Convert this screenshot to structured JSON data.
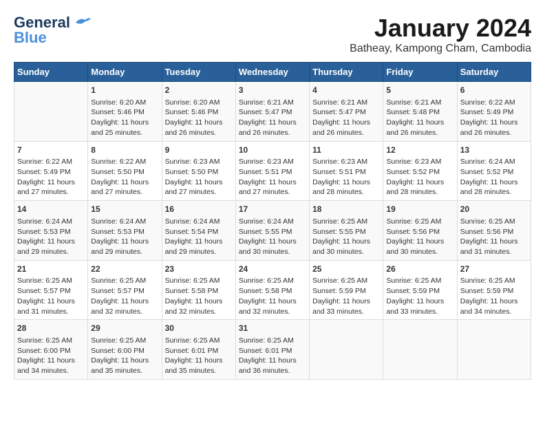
{
  "header": {
    "logo_line1": "General",
    "logo_line2": "Blue",
    "month_title": "January 2024",
    "subtitle": "Batheay, Kampong Cham, Cambodia"
  },
  "days_of_week": [
    "Sunday",
    "Monday",
    "Tuesday",
    "Wednesday",
    "Thursday",
    "Friday",
    "Saturday"
  ],
  "weeks": [
    {
      "days": [
        {
          "num": "",
          "content": ""
        },
        {
          "num": "1",
          "content": "Sunrise: 6:20 AM\nSunset: 5:46 PM\nDaylight: 11 hours\nand 25 minutes."
        },
        {
          "num": "2",
          "content": "Sunrise: 6:20 AM\nSunset: 5:46 PM\nDaylight: 11 hours\nand 26 minutes."
        },
        {
          "num": "3",
          "content": "Sunrise: 6:21 AM\nSunset: 5:47 PM\nDaylight: 11 hours\nand 26 minutes."
        },
        {
          "num": "4",
          "content": "Sunrise: 6:21 AM\nSunset: 5:47 PM\nDaylight: 11 hours\nand 26 minutes."
        },
        {
          "num": "5",
          "content": "Sunrise: 6:21 AM\nSunset: 5:48 PM\nDaylight: 11 hours\nand 26 minutes."
        },
        {
          "num": "6",
          "content": "Sunrise: 6:22 AM\nSunset: 5:49 PM\nDaylight: 11 hours\nand 26 minutes."
        }
      ]
    },
    {
      "days": [
        {
          "num": "7",
          "content": "Sunrise: 6:22 AM\nSunset: 5:49 PM\nDaylight: 11 hours\nand 27 minutes."
        },
        {
          "num": "8",
          "content": "Sunrise: 6:22 AM\nSunset: 5:50 PM\nDaylight: 11 hours\nand 27 minutes."
        },
        {
          "num": "9",
          "content": "Sunrise: 6:23 AM\nSunset: 5:50 PM\nDaylight: 11 hours\nand 27 minutes."
        },
        {
          "num": "10",
          "content": "Sunrise: 6:23 AM\nSunset: 5:51 PM\nDaylight: 11 hours\nand 27 minutes."
        },
        {
          "num": "11",
          "content": "Sunrise: 6:23 AM\nSunset: 5:51 PM\nDaylight: 11 hours\nand 28 minutes."
        },
        {
          "num": "12",
          "content": "Sunrise: 6:23 AM\nSunset: 5:52 PM\nDaylight: 11 hours\nand 28 minutes."
        },
        {
          "num": "13",
          "content": "Sunrise: 6:24 AM\nSunset: 5:52 PM\nDaylight: 11 hours\nand 28 minutes."
        }
      ]
    },
    {
      "days": [
        {
          "num": "14",
          "content": "Sunrise: 6:24 AM\nSunset: 5:53 PM\nDaylight: 11 hours\nand 29 minutes."
        },
        {
          "num": "15",
          "content": "Sunrise: 6:24 AM\nSunset: 5:53 PM\nDaylight: 11 hours\nand 29 minutes."
        },
        {
          "num": "16",
          "content": "Sunrise: 6:24 AM\nSunset: 5:54 PM\nDaylight: 11 hours\nand 29 minutes."
        },
        {
          "num": "17",
          "content": "Sunrise: 6:24 AM\nSunset: 5:55 PM\nDaylight: 11 hours\nand 30 minutes."
        },
        {
          "num": "18",
          "content": "Sunrise: 6:25 AM\nSunset: 5:55 PM\nDaylight: 11 hours\nand 30 minutes."
        },
        {
          "num": "19",
          "content": "Sunrise: 6:25 AM\nSunset: 5:56 PM\nDaylight: 11 hours\nand 30 minutes."
        },
        {
          "num": "20",
          "content": "Sunrise: 6:25 AM\nSunset: 5:56 PM\nDaylight: 11 hours\nand 31 minutes."
        }
      ]
    },
    {
      "days": [
        {
          "num": "21",
          "content": "Sunrise: 6:25 AM\nSunset: 5:57 PM\nDaylight: 11 hours\nand 31 minutes."
        },
        {
          "num": "22",
          "content": "Sunrise: 6:25 AM\nSunset: 5:57 PM\nDaylight: 11 hours\nand 32 minutes."
        },
        {
          "num": "23",
          "content": "Sunrise: 6:25 AM\nSunset: 5:58 PM\nDaylight: 11 hours\nand 32 minutes."
        },
        {
          "num": "24",
          "content": "Sunrise: 6:25 AM\nSunset: 5:58 PM\nDaylight: 11 hours\nand 32 minutes."
        },
        {
          "num": "25",
          "content": "Sunrise: 6:25 AM\nSunset: 5:59 PM\nDaylight: 11 hours\nand 33 minutes."
        },
        {
          "num": "26",
          "content": "Sunrise: 6:25 AM\nSunset: 5:59 PM\nDaylight: 11 hours\nand 33 minutes."
        },
        {
          "num": "27",
          "content": "Sunrise: 6:25 AM\nSunset: 5:59 PM\nDaylight: 11 hours\nand 34 minutes."
        }
      ]
    },
    {
      "days": [
        {
          "num": "28",
          "content": "Sunrise: 6:25 AM\nSunset: 6:00 PM\nDaylight: 11 hours\nand 34 minutes."
        },
        {
          "num": "29",
          "content": "Sunrise: 6:25 AM\nSunset: 6:00 PM\nDaylight: 11 hours\nand 35 minutes."
        },
        {
          "num": "30",
          "content": "Sunrise: 6:25 AM\nSunset: 6:01 PM\nDaylight: 11 hours\nand 35 minutes."
        },
        {
          "num": "31",
          "content": "Sunrise: 6:25 AM\nSunset: 6:01 PM\nDaylight: 11 hours\nand 36 minutes."
        },
        {
          "num": "",
          "content": ""
        },
        {
          "num": "",
          "content": ""
        },
        {
          "num": "",
          "content": ""
        }
      ]
    }
  ]
}
